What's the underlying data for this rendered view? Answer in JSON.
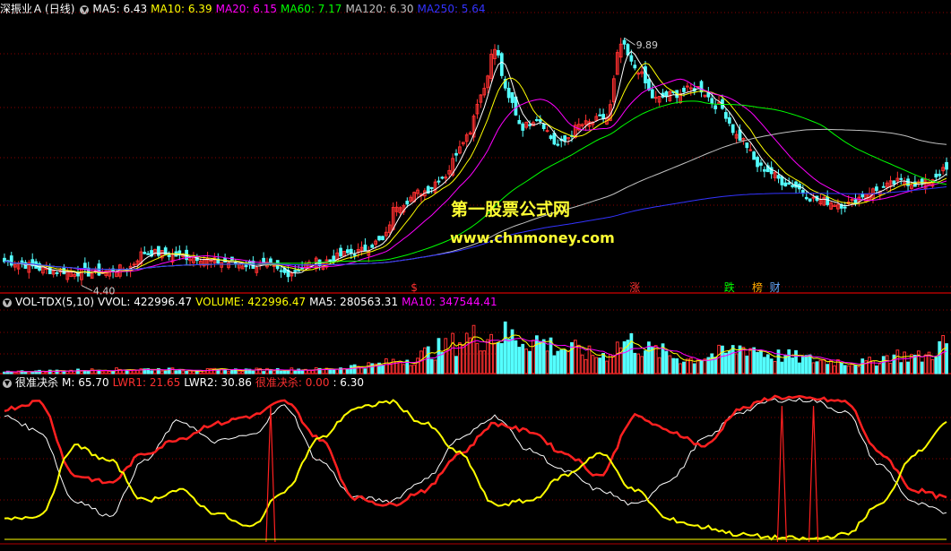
{
  "price_panel": {
    "stock_name": "深振业Ａ",
    "period": "(日线)",
    "ma_labels": [
      {
        "text": "MA5: 6.43",
        "color": "#ffffff"
      },
      {
        "text": "MA10: 6.39",
        "color": "#ffff00"
      },
      {
        "text": "MA20: 6.15",
        "color": "#ff00ff"
      },
      {
        "text": "MA60: 7.17",
        "color": "#00ff00"
      },
      {
        "text": "MA120: 6.30",
        "color": "#c0c0c0"
      },
      {
        "text": "MA250: 5.64",
        "color": "#3333ff"
      }
    ],
    "high_label": "9.89",
    "low_label": "4.40",
    "markers": [
      {
        "text": "$",
        "color": "#ff3030",
        "index": 117
      },
      {
        "text": "涨",
        "color": "#ff3030",
        "index": 180
      },
      {
        "text": "跌",
        "color": "#00ff00",
        "index": 207
      },
      {
        "text": "榜",
        "color": "#ffaa00",
        "index": 215
      },
      {
        "text": "财",
        "color": "#66aaff",
        "index": 220
      }
    ]
  },
  "volume_panel": {
    "indicator": "VOL-TDX(5,10)",
    "labels": [
      {
        "text": "VVOL: 422996.47",
        "color": "#ffffff"
      },
      {
        "text": "VOLUME: 422996.47",
        "color": "#ffff00"
      },
      {
        "text": "MA5: 280563.31",
        "color": "#ffffff"
      },
      {
        "text": "MA10: 347544.41",
        "color": "#ff00ff"
      }
    ]
  },
  "indicator_panel": {
    "name": "很准决杀",
    "labels": [
      {
        "text": "M: 65.70",
        "color": "#ffffff"
      },
      {
        "text": "LWR1: 21.65",
        "color": "#ff3030"
      },
      {
        "text": "LWR2: 30.86",
        "color": "#ffffff"
      },
      {
        "text": "很准决杀: 0.00",
        "color": "#ff3030"
      },
      {
        "text": ": 6.30",
        "color": "#ffffff"
      }
    ]
  },
  "watermark": {
    "line1": "第一股票公式网",
    "line2": "www.chnmoney.com"
  },
  "colors": {
    "up": "#ff3030",
    "down": "#54ffff",
    "ma5": "#ffffff",
    "ma10": "#ffff00",
    "ma20": "#ff00ff",
    "ma60": "#00ff00",
    "ma120": "#c0c0c0",
    "ma250": "#3333ff",
    "grid": "#8a0000"
  },
  "chart_data": [
    {
      "type": "candlestick",
      "title": "深振业Ａ (日线)",
      "bar_count": 270,
      "key_levels": {
        "high": 9.89,
        "low": 4.4
      },
      "ylim": [
        4.2,
        10.2
      ],
      "close_anchors": [
        [
          0,
          4.75
        ],
        [
          15,
          4.55
        ],
        [
          25,
          4.5
        ],
        [
          35,
          4.6
        ],
        [
          40,
          4.95
        ],
        [
          55,
          4.85
        ],
        [
          60,
          4.75
        ],
        [
          75,
          4.65
        ],
        [
          80,
          4.5
        ],
        [
          90,
          4.75
        ],
        [
          100,
          4.95
        ],
        [
          108,
          5.2
        ],
        [
          112,
          6.0
        ],
        [
          120,
          6.3
        ],
        [
          125,
          6.6
        ],
        [
          132,
          7.5
        ],
        [
          136,
          8.4
        ],
        [
          140,
          9.4
        ],
        [
          144,
          8.3
        ],
        [
          148,
          7.7
        ],
        [
          152,
          7.9
        ],
        [
          158,
          7.3
        ],
        [
          165,
          7.75
        ],
        [
          172,
          7.9
        ],
        [
          176,
          9.5
        ],
        [
          180,
          9.0
        ],
        [
          186,
          8.3
        ],
        [
          190,
          8.4
        ],
        [
          198,
          8.55
        ],
        [
          204,
          8.15
        ],
        [
          210,
          7.45
        ],
        [
          216,
          6.8
        ],
        [
          224,
          6.45
        ],
        [
          232,
          6.1
        ],
        [
          240,
          6.0
        ],
        [
          248,
          6.3
        ],
        [
          256,
          6.5
        ],
        [
          262,
          6.45
        ],
        [
          269,
          6.75
        ]
      ],
      "series": [
        {
          "name": "MA5",
          "value": 6.43
        },
        {
          "name": "MA10",
          "value": 6.39
        },
        {
          "name": "MA20",
          "value": 6.15
        },
        {
          "name": "MA60",
          "value": 7.17
        },
        {
          "name": "MA120",
          "value": 6.3
        },
        {
          "name": "MA250",
          "value": 5.64
        }
      ]
    },
    {
      "type": "bar",
      "title": "VOL-TDX(5,10)",
      "volume_anchors": [
        [
          0,
          30000
        ],
        [
          40,
          60000
        ],
        [
          60,
          50000
        ],
        [
          90,
          60000
        ],
        [
          105,
          120000
        ],
        [
          115,
          200000
        ],
        [
          125,
          350000
        ],
        [
          132,
          500000
        ],
        [
          140,
          550000
        ],
        [
          150,
          480000
        ],
        [
          160,
          350000
        ],
        [
          170,
          250000
        ],
        [
          178,
          450000
        ],
        [
          185,
          320000
        ],
        [
          195,
          200000
        ],
        [
          205,
          280000
        ],
        [
          212,
          380000
        ],
        [
          220,
          250000
        ],
        [
          235,
          180000
        ],
        [
          245,
          150000
        ],
        [
          255,
          260000
        ],
        [
          262,
          230000
        ],
        [
          269,
          422996
        ]
      ],
      "ylim": [
        0,
        900000
      ],
      "series": [
        {
          "name": "VVOL",
          "value": 422996.47
        },
        {
          "name": "VOLUME",
          "value": 422996.47
        },
        {
          "name": "MA5",
          "value": 280563.31
        },
        {
          "name": "MA10",
          "value": 347544.41
        }
      ]
    },
    {
      "type": "line",
      "title": "很准决杀",
      "ylim": [
        0,
        100
      ],
      "x": [
        0,
        10,
        20,
        30,
        40,
        50,
        60,
        70,
        80,
        90,
        100,
        110,
        120,
        130,
        140,
        150,
        160,
        170,
        180,
        190,
        200,
        210,
        220,
        230,
        240,
        250,
        260,
        269
      ],
      "series": [
        {
          "name": "M",
          "value": 65.7,
          "values": [
            85,
            75,
            28,
            18,
            55,
            82,
            68,
            72,
            92,
            55,
            30,
            28,
            42,
            70,
            85,
            62,
            48,
            35,
            25,
            42,
            70,
            88,
            96,
            96,
            88,
            52,
            26,
            20
          ]
        },
        {
          "name": "LWR1",
          "values": [
            90,
            95,
            45,
            40,
            60,
            70,
            80,
            85,
            95,
            70,
            30,
            25,
            35,
            60,
            80,
            75,
            60,
            45,
            85,
            75,
            65,
            90,
            98,
            97,
            95,
            60,
            35,
            30
          ]
        },
        {
          "name": "LWR2",
          "values": [
            15,
            18,
            65,
            55,
            28,
            35,
            20,
            10,
            35,
            70,
            90,
            95,
            80,
            60,
            25,
            28,
            45,
            60,
            35,
            15,
            10,
            5,
            3,
            2,
            5,
            25,
            60,
            80
          ]
        },
        {
          "name": "很准决杀",
          "value": 0.0,
          "spikes": [
            76,
            222,
            231
          ]
        }
      ]
    }
  ]
}
